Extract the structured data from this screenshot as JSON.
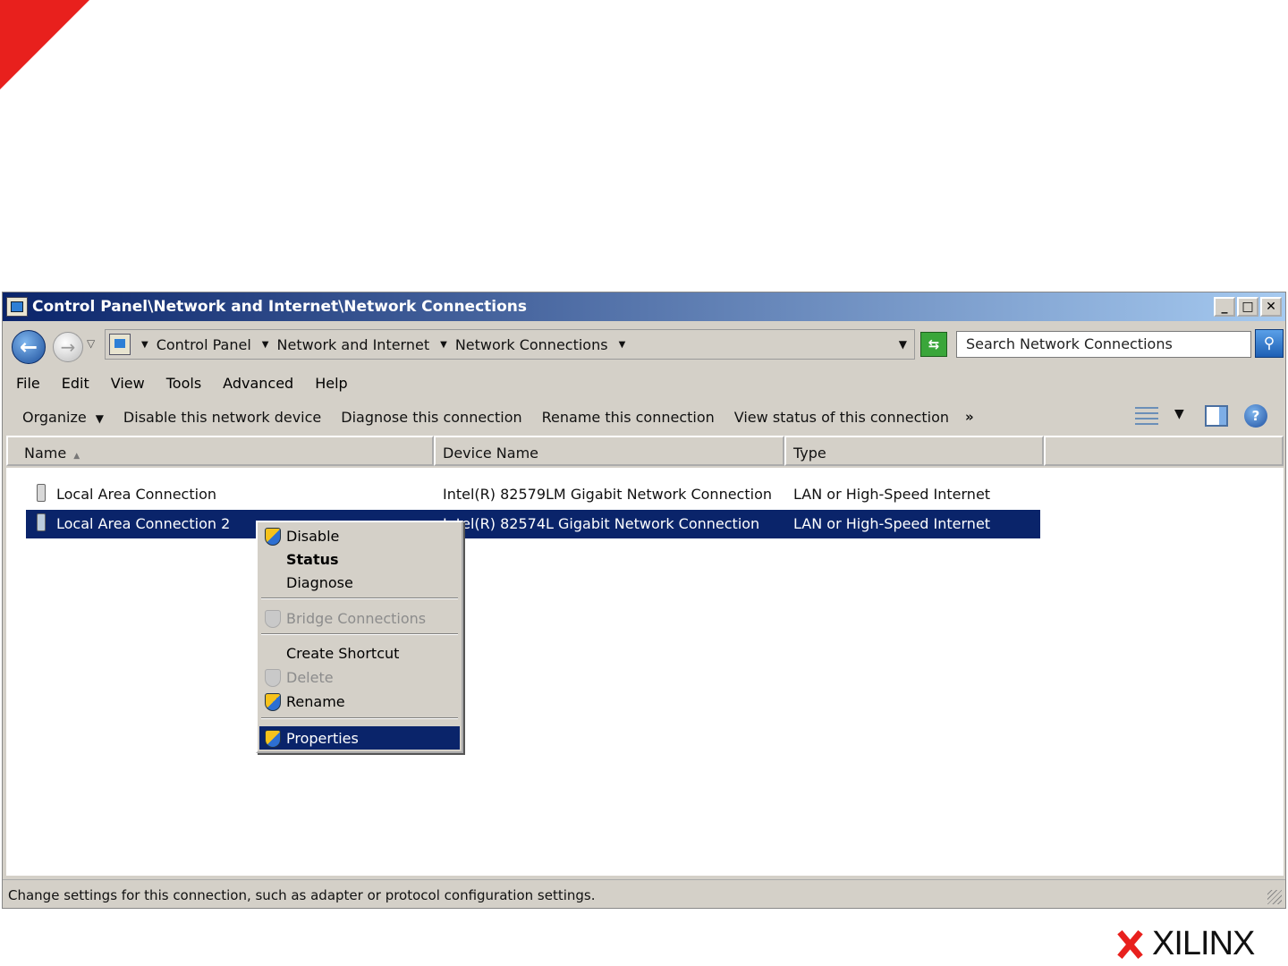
{
  "window": {
    "title": "Control Panel\\Network and Internet\\Network Connections",
    "buttons": {
      "minimize": "_",
      "maximize": "□",
      "close": "✕"
    }
  },
  "address": {
    "crumbs": [
      "Control Panel",
      "Network and Internet",
      "Network Connections"
    ],
    "search_placeholder": "Search Network Connections"
  },
  "menu": [
    "File",
    "Edit",
    "View",
    "Tools",
    "Advanced",
    "Help"
  ],
  "commands": {
    "organize": "Organize",
    "items": [
      "Disable this network device",
      "Diagnose this connection",
      "Rename this connection",
      "View status of this connection"
    ],
    "more": "»"
  },
  "columns": [
    "Name",
    "Device Name",
    "Type"
  ],
  "rows": [
    {
      "name": "Local Area Connection",
      "device": "Intel(R) 82579LM Gigabit Network Connection",
      "type": "LAN or High-Speed Internet",
      "selected": false
    },
    {
      "name": "Local Area Connection 2",
      "device": "Intel(R) 82574L Gigabit Network Connection",
      "type": "LAN or High-Speed Internet",
      "selected": true
    }
  ],
  "context_menu": [
    {
      "label": "Disable",
      "shield": true,
      "enabled": true,
      "bold": false
    },
    {
      "label": "Status",
      "shield": false,
      "enabled": true,
      "bold": true
    },
    {
      "label": "Diagnose",
      "shield": false,
      "enabled": true,
      "bold": false
    },
    {
      "label": "Bridge Connections",
      "shield": true,
      "enabled": false,
      "bold": false
    },
    {
      "label": "Create Shortcut",
      "shield": false,
      "enabled": true,
      "bold": false
    },
    {
      "label": "Delete",
      "shield": true,
      "enabled": false,
      "bold": false
    },
    {
      "label": "Rename",
      "shield": true,
      "enabled": true,
      "bold": false
    },
    {
      "label": "Properties",
      "shield": true,
      "enabled": true,
      "bold": false,
      "highlighted": true
    }
  ],
  "status": "Change settings for this connection, such as adapter or protocol configuration settings.",
  "logo": {
    "text": "XILINX",
    "accent": "#e8201d"
  },
  "colors": {
    "selection": "#0a246a",
    "chrome": "#d4d0c8",
    "title_gradient_start": "#0a246a",
    "title_gradient_end": "#a6caf0"
  }
}
